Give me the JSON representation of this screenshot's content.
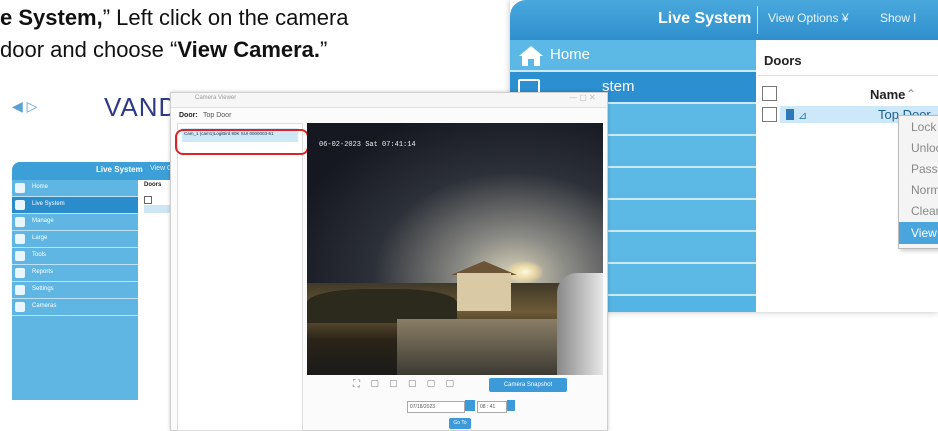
{
  "instruction": {
    "line1_bold": "e System,",
    "line1_rest": "” Left click on the camera",
    "line2_pre": "door and choose “",
    "line2_bold": "View Camera.",
    "line2_post": "”"
  },
  "zoom_panel": {
    "tab_title": "Live System",
    "view_options": "View Options ¥",
    "show_label": "Show l",
    "sidebar": [
      {
        "label": "Home",
        "icon": "home-icon",
        "active": false
      },
      {
        "label": "stem",
        "icon": "monitor-icon",
        "active": true
      },
      {
        "label": "",
        "active": false
      },
      {
        "label": "",
        "active": false
      },
      {
        "label": "",
        "active": false
      },
      {
        "label": "",
        "active": false
      },
      {
        "label": "",
        "active": false
      },
      {
        "label": "",
        "active": false
      }
    ],
    "doors_header": "Doors",
    "column_name": "Name",
    "sort_indicator": "⌃",
    "row_name": "Top Door",
    "context_menu": [
      "Lock",
      "Unlock",
      "Pass",
      "Normalise",
      "Clear Alarms",
      "View Camera"
    ],
    "context_selected": "View Camera"
  },
  "app": {
    "nav_arrows": "◀ ▷",
    "logo": "VANDERBILT",
    "tab_title": "Live System",
    "view_options": "View Op",
    "sidebar": [
      "Home",
      "Live System",
      "Manage",
      "Large",
      "Tools",
      "Reports",
      "Settings",
      "Cameras"
    ],
    "doors_header": "Doors"
  },
  "camera_window": {
    "title": "Camera Viewer",
    "door_label": "Door:",
    "door_value": "Top Door",
    "camera_entry": "Cam_1 (cam1)LogiBird 80K SUI 0000003-61",
    "timestamp": "06-02-2023 Sat 07:41:14",
    "controls": "⛶ ▢ ▢ ▢ ▢ ▢",
    "snapshot_button": "Camera Snapshot",
    "date_value": "07/18/2023",
    "time_value": "08 : 41",
    "goto_button": "Go To"
  }
}
